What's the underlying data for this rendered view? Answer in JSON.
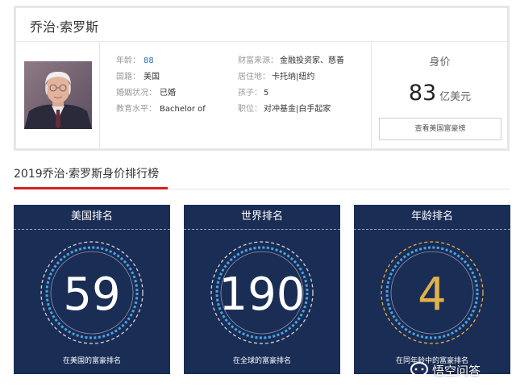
{
  "profile": {
    "name": "乔治·索罗斯",
    "left_fields": [
      {
        "label": "年龄：",
        "value": "88",
        "accent": true
      },
      {
        "label": "国籍：",
        "value": "美国",
        "accent": false
      },
      {
        "label": "婚姻状况：",
        "value": "已婚",
        "accent": false
      },
      {
        "label": "教育水平：",
        "value": "Bachelor of",
        "accent": false
      }
    ],
    "right_fields": [
      {
        "label": "财富来源：",
        "value": "金融投资家、慈善"
      },
      {
        "label": "居住地：",
        "value": "卡托纳|纽约"
      },
      {
        "label": "孩子：",
        "value": "5"
      },
      {
        "label": "职位：",
        "value": "对冲基金|白手起家"
      }
    ],
    "worth": {
      "label": "身价",
      "value": "83",
      "unit": "亿美元",
      "button": "查看美国富豪榜"
    }
  },
  "ranking": {
    "title": "2019乔治·索罗斯身价排行榜",
    "panels": [
      {
        "title": "美国排名",
        "value": "59",
        "caption": "在美国的富豪排名",
        "ring_color": "#4aa3e0",
        "value_color": "#ffffff"
      },
      {
        "title": "世界排名",
        "value": "190",
        "caption": "在全球的富豪排名",
        "ring_color": "#4aa3e0",
        "value_color": "#ffffff"
      },
      {
        "title": "年龄排名",
        "value": "4",
        "caption": "在同年龄中的富豪排名",
        "ring_color": "#e0b24a",
        "value_color": "#e0b24a"
      }
    ]
  },
  "watermark": {
    "text": "悟空问答"
  },
  "colors": {
    "panel_bg": "#1a2d55",
    "accent_red": "#d71f1f",
    "link_blue": "#2c6fb1"
  }
}
